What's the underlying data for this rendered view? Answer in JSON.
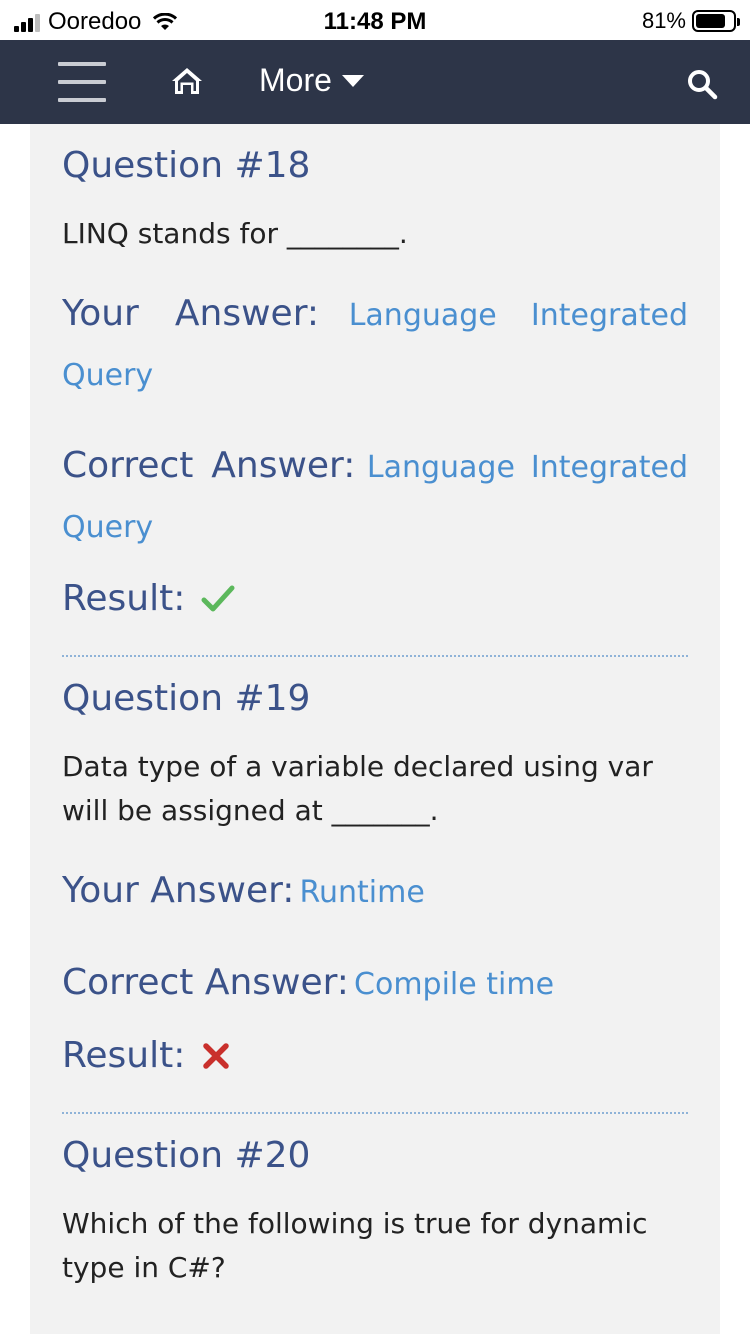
{
  "status_bar": {
    "carrier": "Ooredoo",
    "time": "11:48 PM",
    "battery": "81%",
    "battery_level": 0.81
  },
  "navbar": {
    "more_label": "More"
  },
  "labels": {
    "your_answer": "Your Answer:",
    "correct_answer": "Correct Answer:",
    "result": "Result:"
  },
  "questions": [
    {
      "title": "Question #18",
      "text": "LINQ stands for ________.",
      "your_answer": "Language Integrated Query",
      "correct_answer": "Language Integrated Query",
      "result": "correct"
    },
    {
      "title": "Question #19",
      "text": "Data type of a variable declared using var will be assigned at _______.",
      "your_answer": "Runtime",
      "correct_answer": "Compile time",
      "result": "wrong"
    },
    {
      "title": "Question #20",
      "text": "Which of the following is true for dynamic type in C#?"
    }
  ],
  "colors": {
    "nav_bg": "#2d3548",
    "label": "#3b5289",
    "value": "#4a8fd0",
    "check": "#5cb85c",
    "cross": "#c9302c"
  }
}
